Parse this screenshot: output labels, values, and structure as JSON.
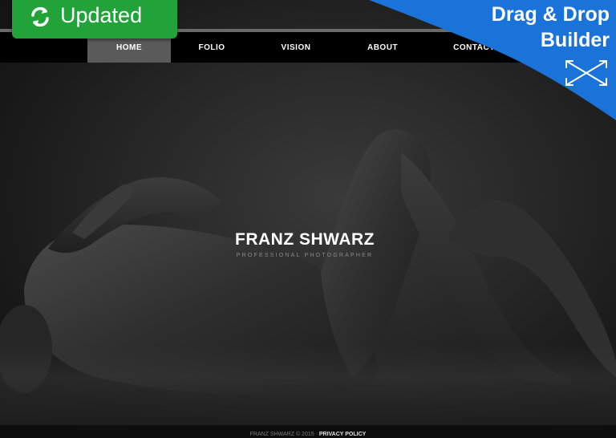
{
  "nav": {
    "items": [
      {
        "label": "HOME"
      },
      {
        "label": "FOLIO"
      },
      {
        "label": "VISION"
      },
      {
        "label": "ABOUT"
      },
      {
        "label": "CONTACT"
      }
    ],
    "active_index": 0
  },
  "hero": {
    "title": "FRANZ SHWARZ",
    "subtitle": "PROFESSIONAL PHOTOGRAPHER"
  },
  "footer": {
    "copyright": "FRANZ SHWARZ © 2015 · ",
    "privacy_link": "PRIVACY POLICY"
  },
  "badges": {
    "updated": {
      "label": "Updated",
      "icon": "refresh-icon",
      "color": "#22a33a"
    },
    "builder": {
      "line1": "Drag & Drop",
      "line2": "Builder",
      "icon": "move-arrows-icon",
      "color": "#1a73d9"
    }
  }
}
